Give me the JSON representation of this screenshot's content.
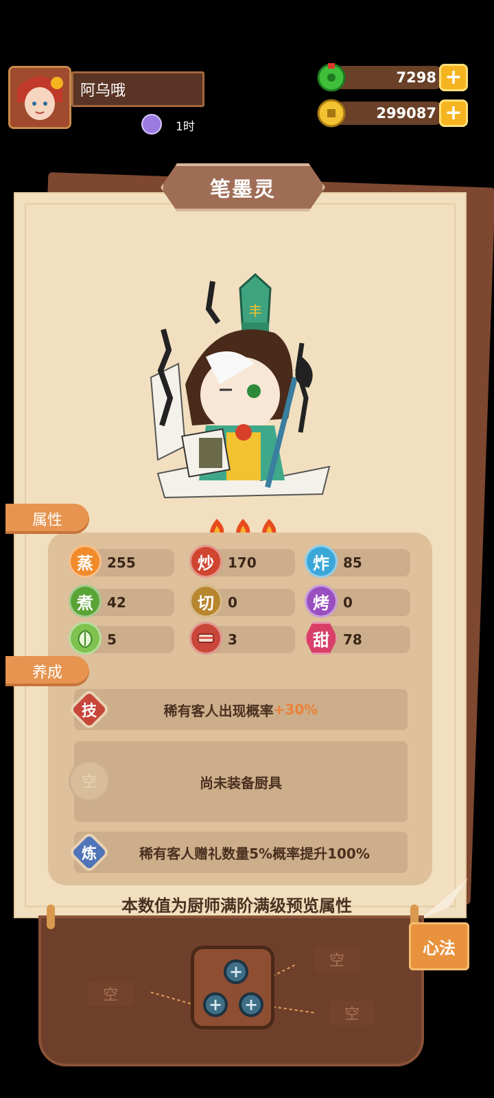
{
  "player": {
    "name": "阿乌哦",
    "timer": "1时"
  },
  "currency": {
    "jade": "7298",
    "gold": "299087"
  },
  "chef": {
    "name": "笔墨灵"
  },
  "tabs": {
    "attributes": "属性",
    "training": "养成"
  },
  "stats": [
    {
      "label": "蒸",
      "value": "255",
      "color": "#f08a2a"
    },
    {
      "label": "炒",
      "value": "170",
      "color": "#d0452f"
    },
    {
      "label": "炸",
      "value": "85",
      "color": "#3aa7d8"
    },
    {
      "label": "煮",
      "value": "42",
      "color": "#5aa436"
    },
    {
      "label": "切",
      "value": "0",
      "color": "#b7862f"
    },
    {
      "label": "烤",
      "value": "0",
      "color": "#9a4fc0"
    },
    {
      "label": "",
      "value": "5",
      "color": "#7fc24f"
    },
    {
      "label": "",
      "value": "3",
      "color": "#c8463a"
    },
    {
      "label": "甜",
      "value": "78",
      "color": "#d8406a"
    }
  ],
  "training": {
    "skill": {
      "badge": "技",
      "text": "稀有客人出现概率",
      "bonus": "+30%"
    },
    "equipment": {
      "badge": "空",
      "text": "尚未装备厨具"
    },
    "refine": {
      "badge": "炼",
      "text": "稀有客人赠礼数量5%概率提升100%"
    }
  },
  "note": "本数值为厨师满阶满级预览属性",
  "xinfa": {
    "button": "心法",
    "empty_label": "空",
    "plus": "+"
  }
}
